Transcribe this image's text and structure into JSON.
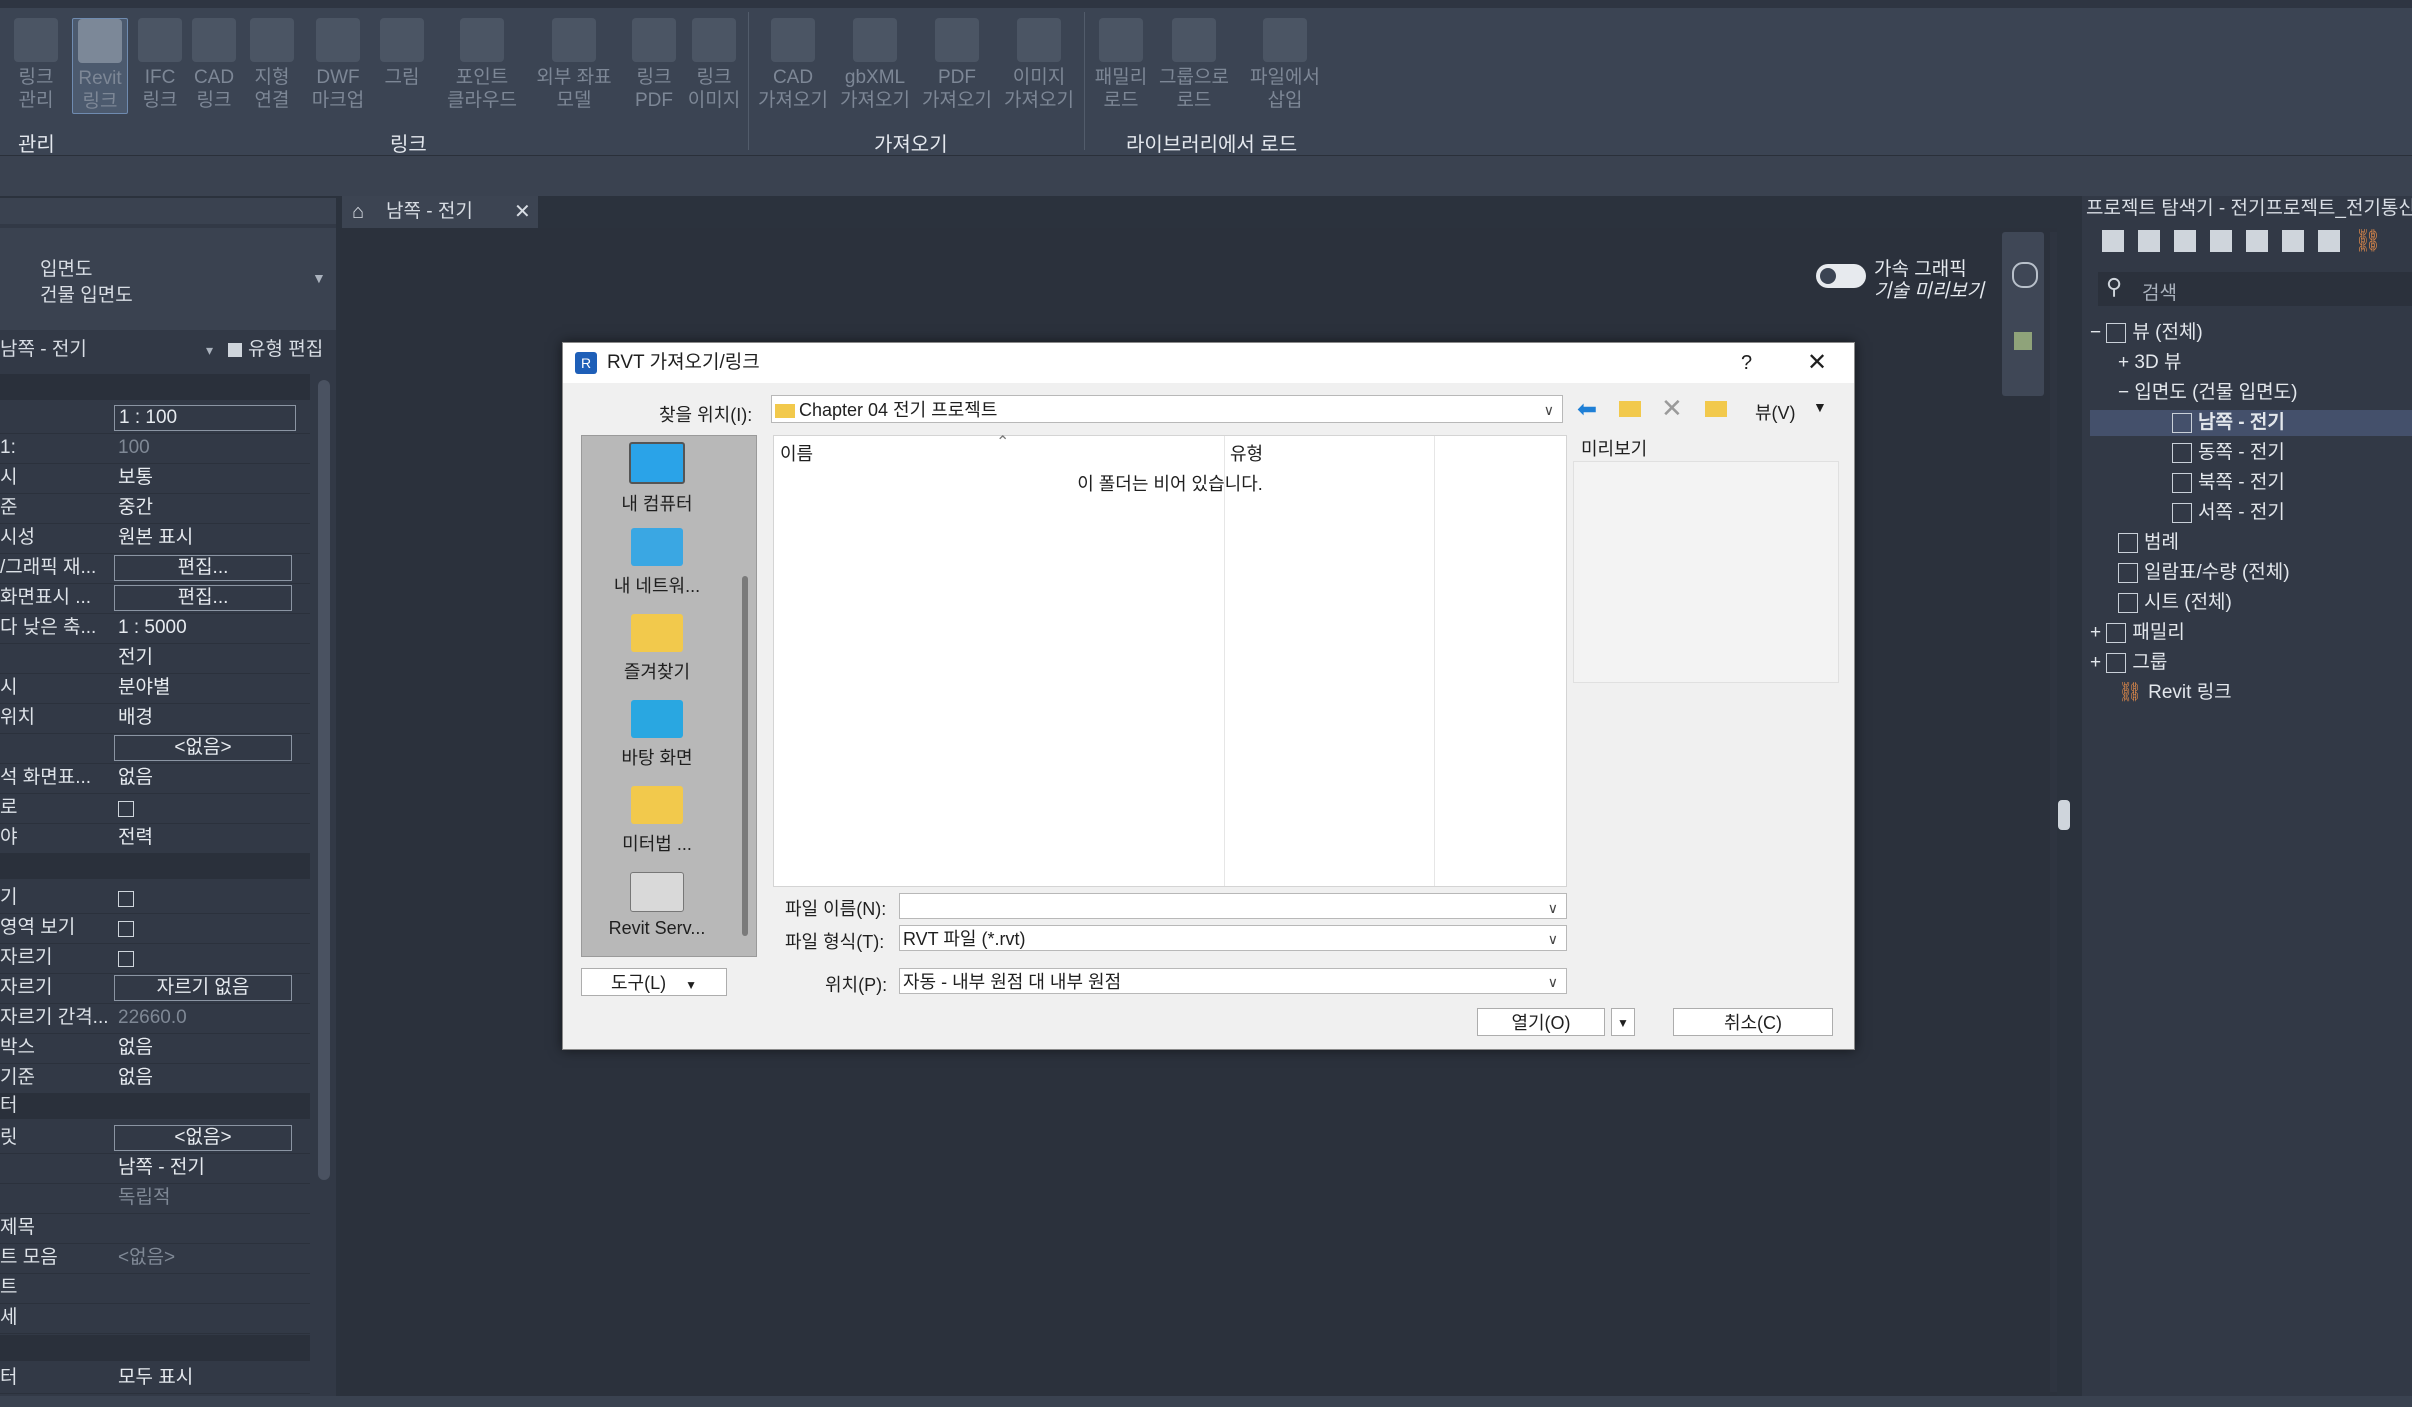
{
  "ribbon": {
    "buttons": [
      {
        "line1": "링크",
        "line2": "관리"
      },
      {
        "line1": "Revit",
        "line2": "링크"
      },
      {
        "line1": "IFC",
        "line2": "링크"
      },
      {
        "line1": "CAD",
        "line2": "링크"
      },
      {
        "line1": "지형",
        "line2": "연결"
      },
      {
        "line1": "DWF",
        "line2": "마크업"
      },
      {
        "line1": "그림",
        "line2": ""
      },
      {
        "line1": "포인트",
        "line2": "클라우드"
      },
      {
        "line1": "외부 좌표",
        "line2": "모델"
      },
      {
        "line1": "링크",
        "line2": "PDF"
      },
      {
        "line1": "링크",
        "line2": "이미지"
      },
      {
        "line1": "CAD",
        "line2": "가져오기"
      },
      {
        "line1": "gbXML",
        "line2": "가져오기"
      },
      {
        "line1": "PDF",
        "line2": "가져오기"
      },
      {
        "line1": "이미지",
        "line2": "가져오기"
      },
      {
        "line1": "패밀리",
        "line2": "로드"
      },
      {
        "line1": "그룹으로",
        "line2": "로드"
      },
      {
        "line1": "파일에서",
        "line2": "삽입"
      }
    ],
    "groups": {
      "manage": "관리",
      "link": "링크",
      "import": "가져오기",
      "library": "라이브러리에서 로드"
    }
  },
  "properties": {
    "type_name": "입면도",
    "type_sub": "건물 입면도",
    "view_selector": "남쪽 - 전기",
    "edit_type": "유형 편집",
    "rows": [
      {
        "k": "",
        "v": "1 : 100"
      },
      {
        "k": "1:",
        "v": "100"
      },
      {
        "k": "시",
        "v": "보통"
      },
      {
        "k": "준",
        "v": "중간"
      },
      {
        "k": "시성",
        "v": "원본 표시"
      },
      {
        "k": "/그래픽 재...",
        "v": "편집..."
      },
      {
        "k": "화면표시 ...",
        "v": "편집..."
      },
      {
        "k": "다 낮은 축...",
        "v": "1 : 5000"
      },
      {
        "k": "",
        "v": "전기"
      },
      {
        "k": "시",
        "v": "분야별"
      },
      {
        "k": "위치",
        "v": "배경"
      },
      {
        "k": "",
        "v": "<없음>"
      },
      {
        "k": "석 화면표...",
        "v": "없음"
      },
      {
        "k": "로",
        "v": ""
      },
      {
        "k": "야",
        "v": "전력"
      },
      {
        "k": "기",
        "v": ""
      },
      {
        "k": "영역 보기",
        "v": ""
      },
      {
        "k": "자르기",
        "v": ""
      },
      {
        "k": "자르기",
        "v": "자르기 없음"
      },
      {
        "k": "자르기 간격...",
        "v": "22660.0"
      },
      {
        "k": "박스",
        "v": "없음"
      },
      {
        "k": "기준",
        "v": "없음"
      },
      {
        "k": "릿",
        "v": "<없음>"
      },
      {
        "k": "",
        "v": "남쪽 - 전기"
      },
      {
        "k": "",
        "v": "독립적"
      },
      {
        "k": "제목",
        "v": ""
      },
      {
        "k": "트 모음",
        "v": "<없음>"
      },
      {
        "k": "트",
        "v": ""
      },
      {
        "k": "세",
        "v": ""
      },
      {
        "k": "터",
        "v": "모두 표시"
      }
    ],
    "section_label": "터"
  },
  "view_tab": {
    "label": "남쪽 - 전기"
  },
  "canvas": {
    "accel_label": "가속 그래픽",
    "accel_sub": "기술 미리보기"
  },
  "browser": {
    "title": "프로젝트 탐색기 - 전기프로젝트_전기통신",
    "search_placeholder": "검색",
    "items": [
      {
        "label": "뷰 (전체)"
      },
      {
        "label": "3D 뷰"
      },
      {
        "label": "입면도 (건물 입면도)"
      },
      {
        "label": "남쪽 - 전기"
      },
      {
        "label": "동쪽 - 전기"
      },
      {
        "label": "북쪽 - 전기"
      },
      {
        "label": "서쪽 - 전기"
      },
      {
        "label": "범례"
      },
      {
        "label": "일람표/수량 (전체)"
      },
      {
        "label": "시트 (전체)"
      },
      {
        "label": "패밀리"
      },
      {
        "label": "그룹"
      },
      {
        "label": "Revit 링크"
      }
    ]
  },
  "dialog": {
    "title": "RVT 가져오기/링크",
    "help": "?",
    "look_in_label": "찾을 위치(I):",
    "look_in_value": "Chapter 04 전기 프로젝트",
    "view_menu": "뷰(V)",
    "places": [
      "내 컴퓨터",
      "내 네트워...",
      "즐겨찾기",
      "바탕 화면",
      "미터법 ...",
      "Revit Serv..."
    ],
    "columns": {
      "name": "이름",
      "type": "유형"
    },
    "empty_msg": "이 폴더는 비어 있습니다.",
    "preview_label": "미리보기",
    "filename_label": "파일 이름(N):",
    "filename_value": "",
    "filetype_label": "파일 형식(T):",
    "filetype_value": "RVT 파일 (*.rvt)",
    "position_label": "위치(P):",
    "position_value": "자동 - 내부 원점 대 내부 원점",
    "tools_button": "도구(L)",
    "open_button": "열기(O)",
    "cancel_button": "취소(C)"
  },
  "colors": {
    "accent": "#1e7fd6",
    "folder": "#f2c94c",
    "selection": "#44506b"
  }
}
